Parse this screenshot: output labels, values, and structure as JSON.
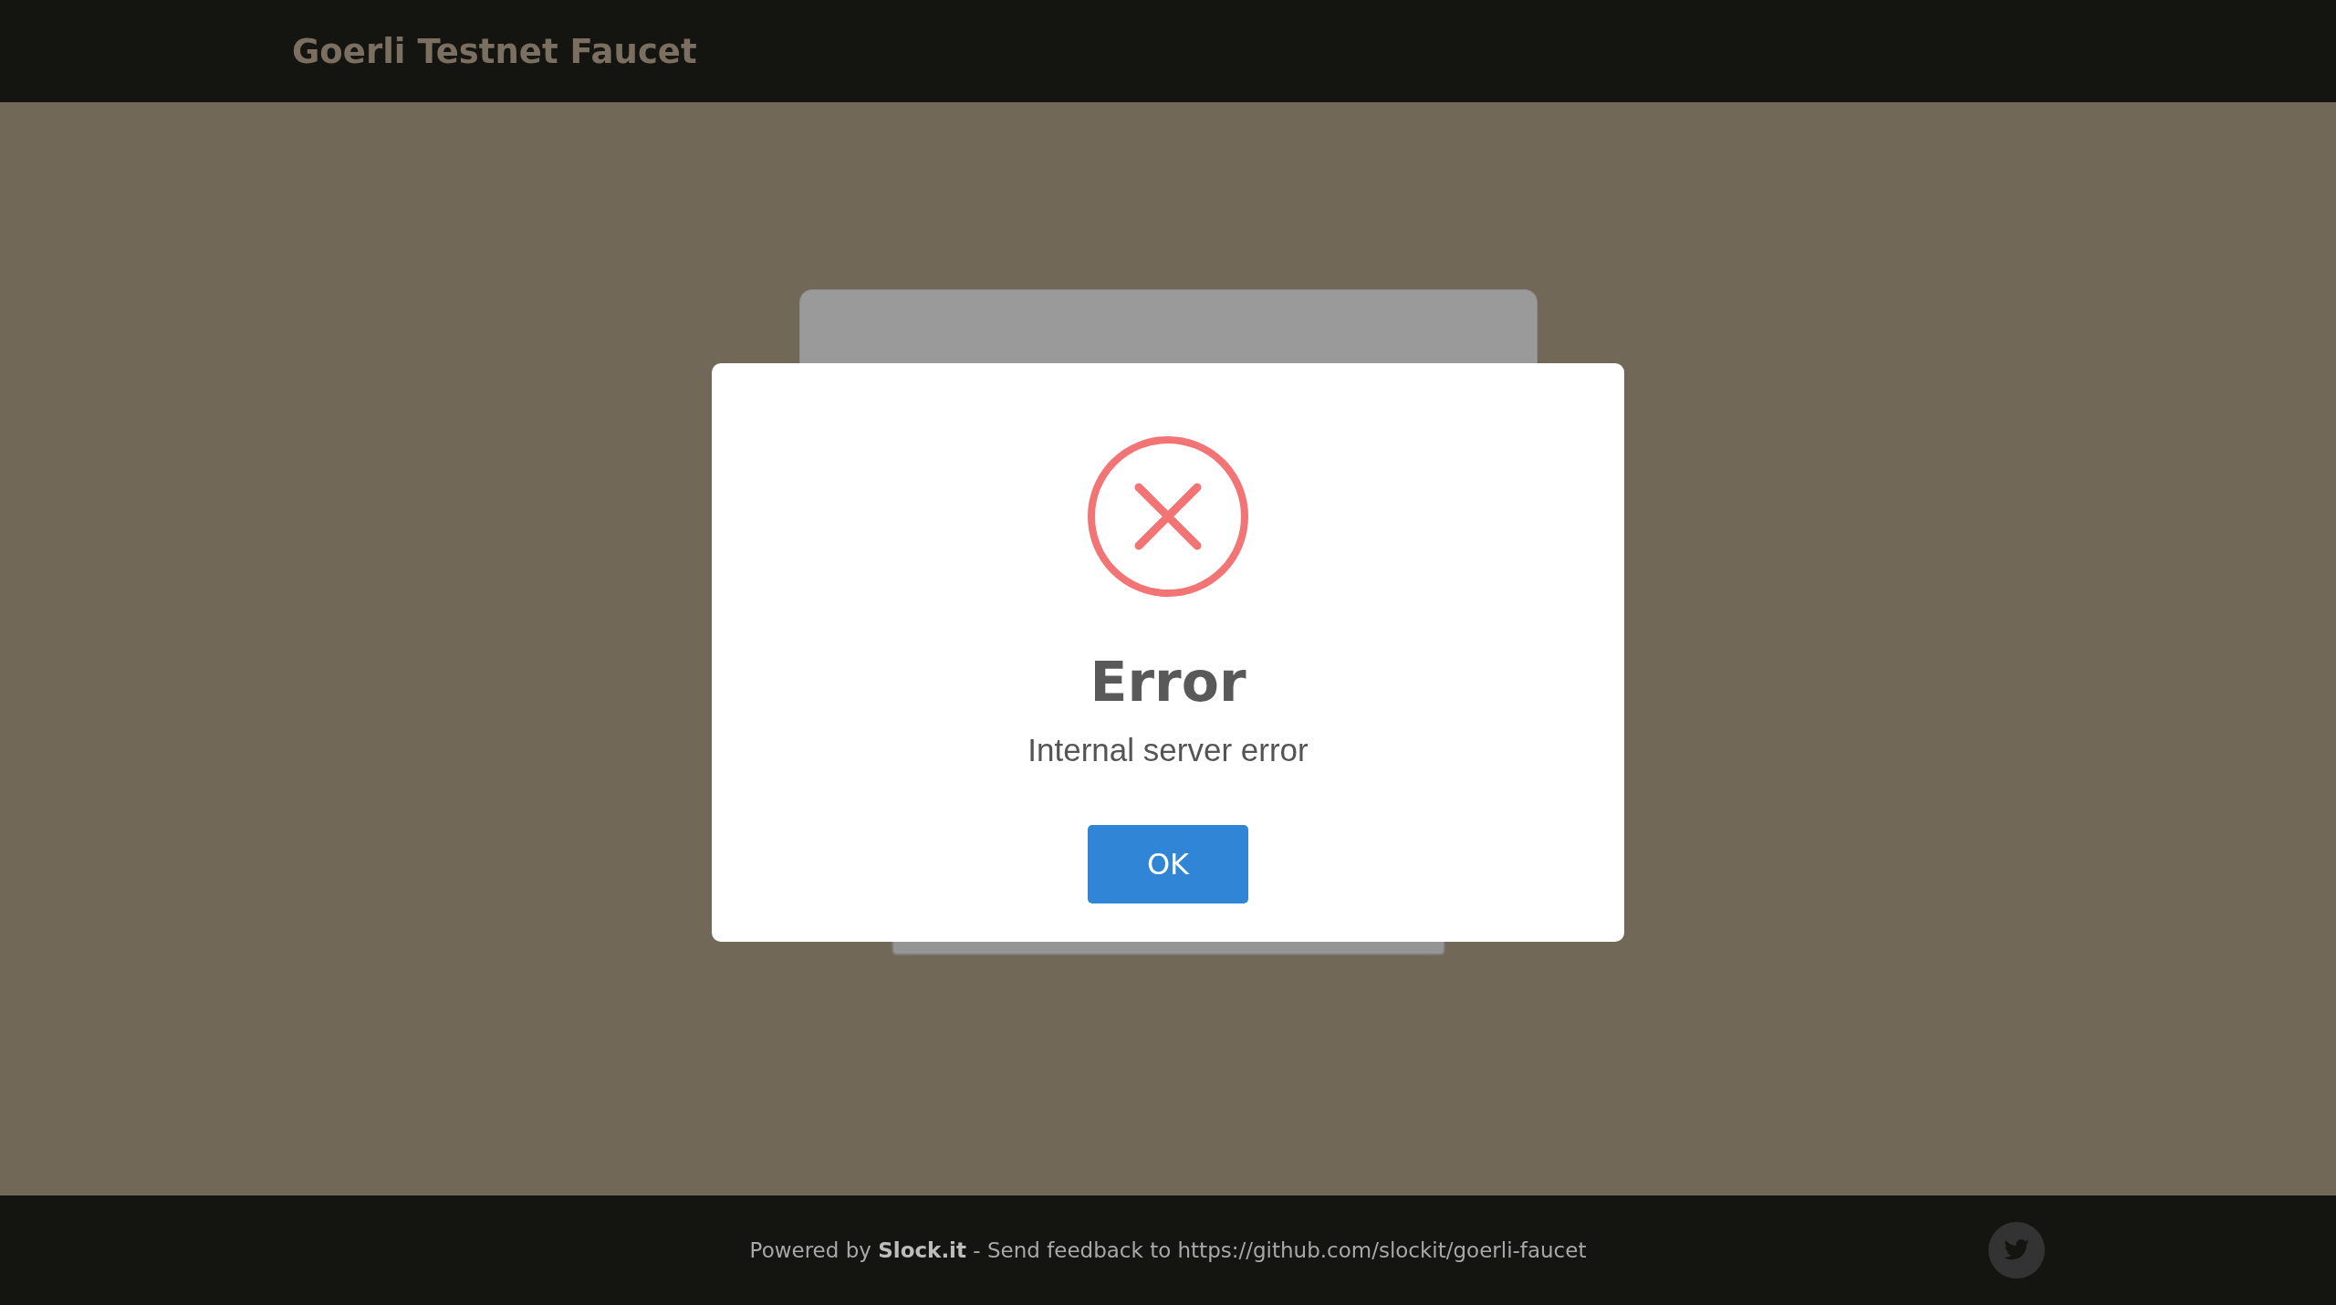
{
  "header": {
    "title": "Goerli Testnet Faucet"
  },
  "dialog": {
    "kind": "error",
    "title": "Error",
    "message": "Internal server error",
    "button": "OK"
  },
  "footer": {
    "prefix": "Powered by ",
    "brand": "Slock.it",
    "suffix": " - Send feedback to https://github.com/slockit/goerli-faucet"
  }
}
